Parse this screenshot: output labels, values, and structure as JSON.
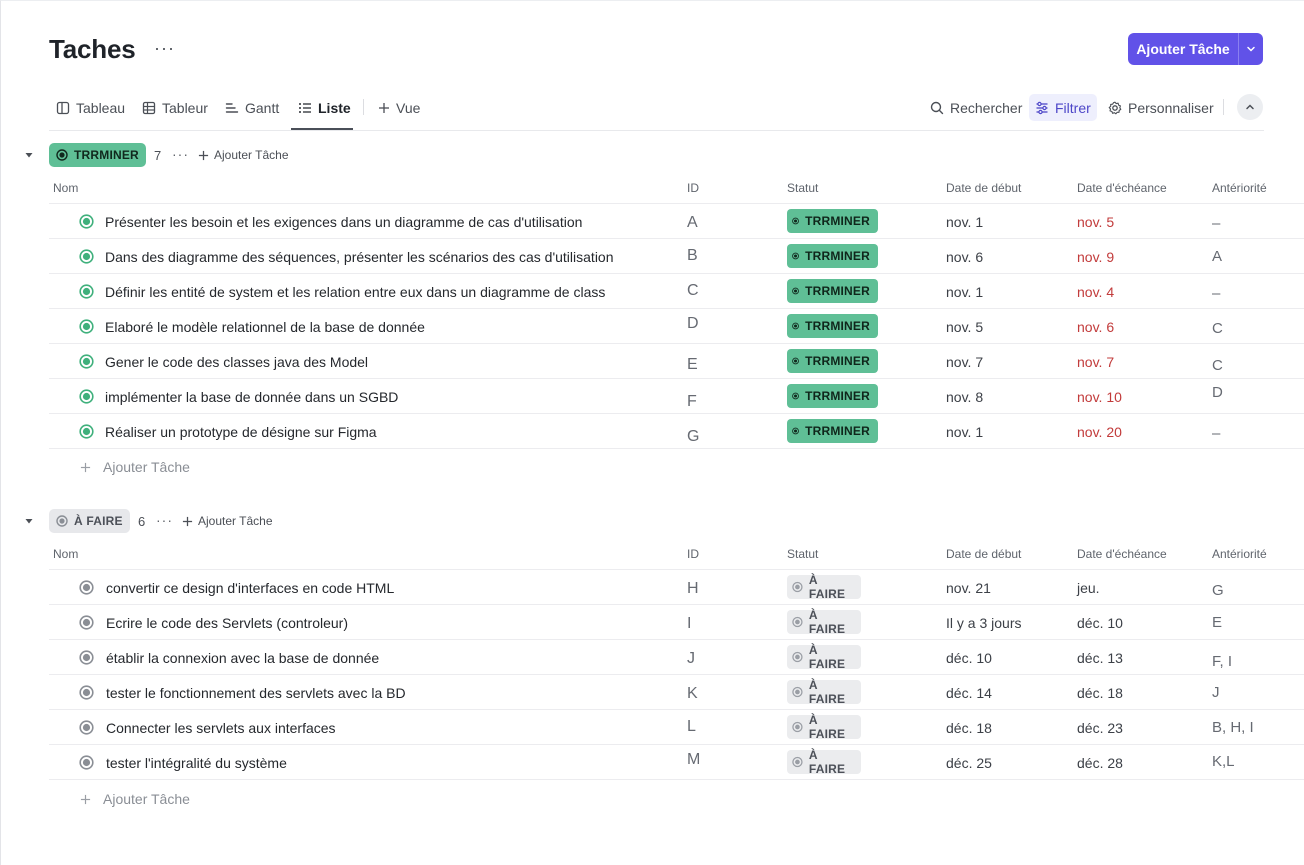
{
  "header": {
    "title": "Taches",
    "more": "···",
    "add_task_label": "Ajouter Tâche"
  },
  "views": {
    "tabs": [
      {
        "label": "Tableau",
        "icon": "board-icon"
      },
      {
        "label": "Tableur",
        "icon": "table-icon"
      },
      {
        "label": "Gantt",
        "icon": "gantt-icon"
      },
      {
        "label": "Liste",
        "icon": "list-icon",
        "active": true
      }
    ],
    "add_view_label": "Vue",
    "search_label": "Rechercher",
    "filter_label": "Filtrer",
    "customize_label": "Personnaliser"
  },
  "columns": {
    "name": "Nom",
    "id": "ID",
    "status": "Statut",
    "start": "Date de début",
    "due": "Date d'échéance",
    "prior": "Antériorité"
  },
  "colors": {
    "accent": "#6152e8",
    "done": "#5fbf96",
    "todo": "#e7e8eb",
    "overdue": "#c23b3b"
  },
  "groups": [
    {
      "label": "TRRMINER",
      "count": "7",
      "more": "···",
      "add_label": "Ajouter Tâche",
      "add_row_label": "Ajouter Tâche",
      "tasks": [
        {
          "name": "Présenter les besoin et les exigences dans un diagramme de cas d'utilisation",
          "id": "A",
          "status": "TRRMINER",
          "start": "nov. 1",
          "due": "nov. 5",
          "prior": "–"
        },
        {
          "name": "Dans des diagramme des séquences, présenter les scénarios des cas d'utilisation",
          "id": "B",
          "status": "TRRMINER",
          "start": "nov. 6",
          "due": "nov. 9",
          "prior": "A"
        },
        {
          "name": "Définir les entité de system et les relation entre eux dans un diagramme de class",
          "id": "C",
          "status": "TRRMINER",
          "start": "nov. 1",
          "due": "nov. 4",
          "prior": "–"
        },
        {
          "name": "Elaboré le modèle relationnel de la base de donnée",
          "id": "D",
          "status": "TRRMINER",
          "start": "nov. 5",
          "due": "nov. 6",
          "prior": "C"
        },
        {
          "name": "Gener le code des classes java des Model",
          "id": "E",
          "status": "TRRMINER",
          "start": "nov. 7",
          "due": "nov. 7",
          "prior": "C"
        },
        {
          "name": "implémenter la base de donnée dans un SGBD",
          "id": "F",
          "status": "TRRMINER",
          "start": "nov. 8",
          "due": "nov. 10",
          "prior": "D"
        },
        {
          "name": "Réaliser un prototype de désigne sur Figma",
          "id": "G",
          "status": "TRRMINER",
          "start": "nov. 1",
          "due": "nov. 20",
          "prior": "–"
        }
      ]
    },
    {
      "label": "À FAIRE",
      "count": "6",
      "more": "···",
      "add_label": "Ajouter Tâche",
      "add_row_label": "Ajouter Tâche",
      "tasks": [
        {
          "name": "convertir ce design d'interfaces en code HTML",
          "id": "H",
          "status": "À FAIRE",
          "start": "nov. 21",
          "due": "jeu.",
          "prior": "G"
        },
        {
          "name": "Ecrire le code des Servlets (controleur)",
          "id": "I",
          "status": "À FAIRE",
          "start": "Il y a 3 jours",
          "due": "déc. 10",
          "prior": "E"
        },
        {
          "name": "établir la connexion avec la base de donnée",
          "id": "J",
          "status": "À FAIRE",
          "start": "déc. 10",
          "due": "déc. 13",
          "prior": "F, I"
        },
        {
          "name": "tester le fonctionnement des servlets avec la BD",
          "id": "K",
          "status": "À FAIRE",
          "start": "déc. 14",
          "due": "déc. 18",
          "prior": "J"
        },
        {
          "name": "Connecter les servlets aux interfaces",
          "id": "L",
          "status": "À FAIRE",
          "start": "déc. 18",
          "due": "déc. 23",
          "prior": "B, H, I"
        },
        {
          "name": "tester l'intégralité du système",
          "id": "M",
          "status": "À FAIRE",
          "start": "déc. 25",
          "due": "déc. 28",
          "prior": "K,L"
        }
      ]
    }
  ]
}
